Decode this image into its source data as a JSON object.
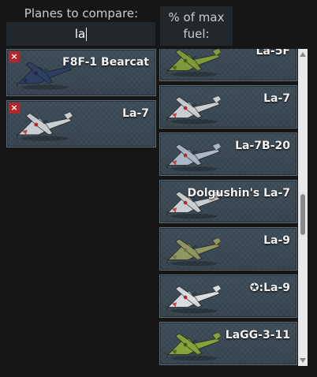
{
  "compare_panel": {
    "title": "Planes to compare:",
    "search_value": "la",
    "selected": [
      {
        "name": "F8F-1 Bearcat",
        "color": "#2f3f63",
        "accent": "#1f2a44"
      },
      {
        "name": "La-7",
        "color": "#c9ced2",
        "accent": "#b02a2a"
      }
    ],
    "remove_label": "×"
  },
  "fuel_header": {
    "line1": "% of max",
    "line2": "fuel:"
  },
  "results": [
    {
      "name": "La-5F",
      "color": "#7f9a3a",
      "accent": "#3c5a1e"
    },
    {
      "name": "La-7",
      "color": "#c9ced2",
      "accent": "#b02a2a"
    },
    {
      "name": "La-7B-20",
      "color": "#a9b7c6",
      "accent": "#b02a2a"
    },
    {
      "name": "Dolgushin's La-7",
      "color": "#c9ced2",
      "accent": "#b02a2a"
    },
    {
      "name": "La-9",
      "color": "#8f9660",
      "accent": "#6b7446"
    },
    {
      "name": "La-9",
      "color": "#d8dde2",
      "accent": "#b02a2a",
      "prefix": "✪:"
    },
    {
      "name": "LaGG-3-11",
      "color": "#86a33a",
      "accent": "#3c5a1e"
    }
  ]
}
